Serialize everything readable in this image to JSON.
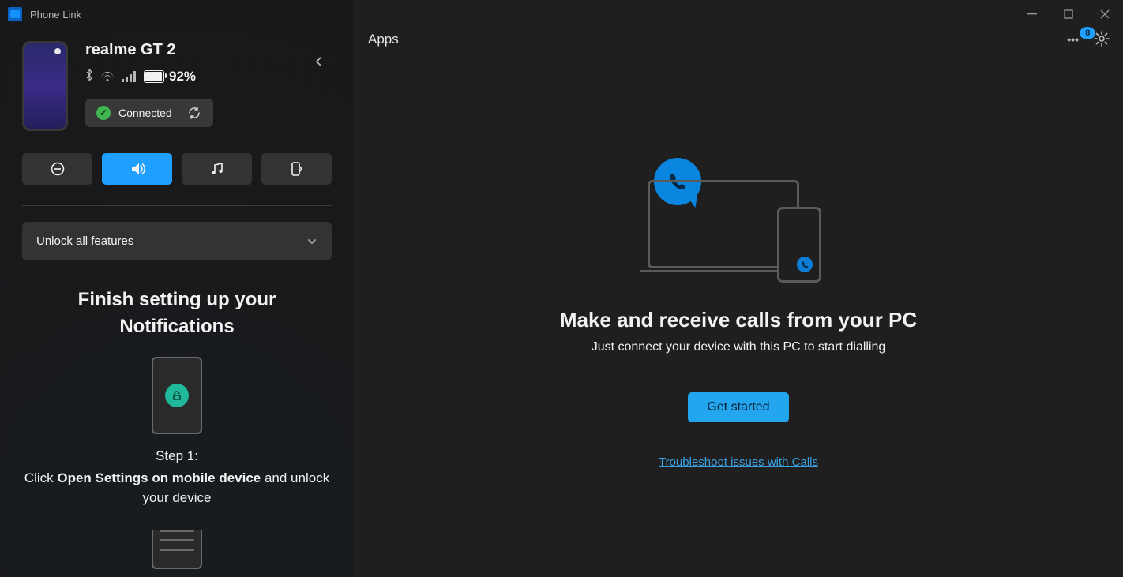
{
  "window": {
    "title": "Phone Link"
  },
  "sidebar": {
    "device_name": "realme GT 2",
    "battery": "92%",
    "status_label": "Connected",
    "unlock_label": "Unlock all features",
    "setup": {
      "heading_l1": "Finish setting up your",
      "heading_l2": "Notifications",
      "step_label": "Step 1:",
      "prefix": "Click ",
      "bold": "Open Settings on mobile device",
      "suffix": " and unlock your device"
    },
    "quick_actions": {
      "dnd": "dnd",
      "sound": "sound",
      "music": "music",
      "mirror": "mirror"
    }
  },
  "topbar": {
    "tab_apps": "Apps",
    "badge": "8"
  },
  "hero": {
    "title": "Make and receive calls from your PC",
    "subtitle": "Just connect your device with this PC to start dialling",
    "cta": "Get started",
    "troubleshoot": "Troubleshoot issues with Calls"
  }
}
